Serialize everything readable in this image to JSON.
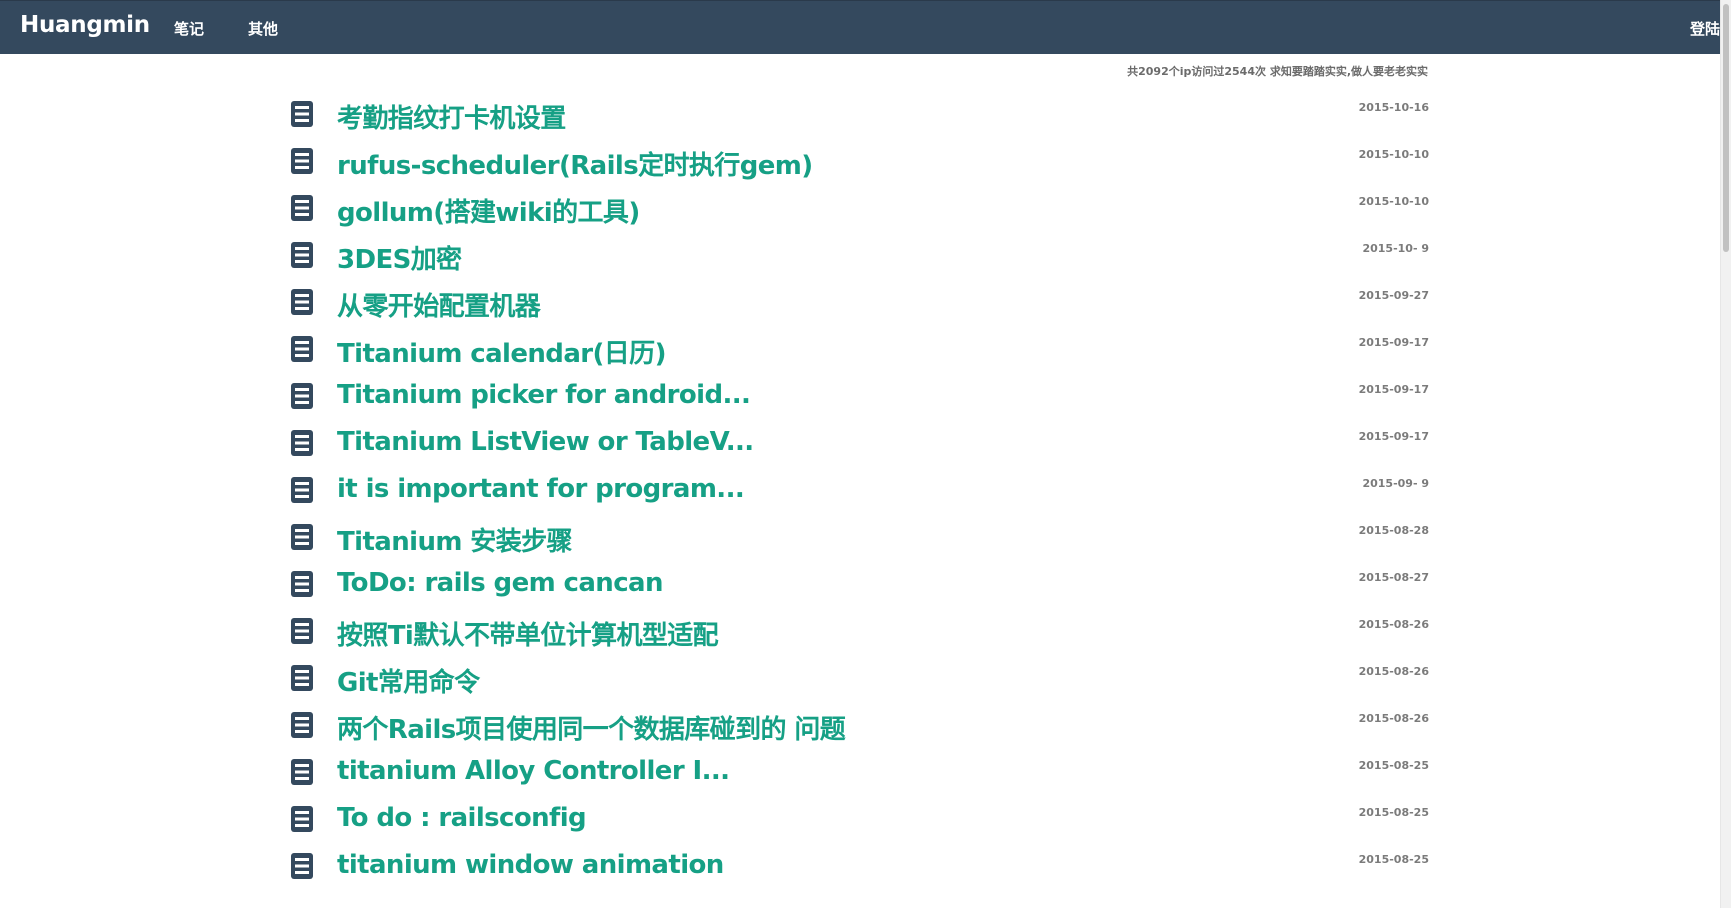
{
  "nav": {
    "brand": "Huangmin",
    "links": [
      "笔记",
      "其他"
    ],
    "login": "登陆"
  },
  "stats": {
    "text": "共2092个ip访问过2544次 求知要踏踏实实,做人要老老实实"
  },
  "icons": {
    "post": "document-icon"
  },
  "colors": {
    "navbar": "#34495e",
    "title": "#16a085",
    "icon": "#34495e"
  },
  "posts": [
    {
      "title": "考勤指纹打卡机设置",
      "date": "2015-10-16"
    },
    {
      "title": "rufus-scheduler(Rails定时执行gem)",
      "date": "2015-10-10"
    },
    {
      "title": "gollum(搭建wiki的工具)",
      "date": "2015-10-10"
    },
    {
      "title": "3DES加密",
      "date": "2015-10- 9"
    },
    {
      "title": "从零开始配置机器",
      "date": "2015-09-27"
    },
    {
      "title": "Titanium calendar(日历)",
      "date": "2015-09-17"
    },
    {
      "title": "Titanium picker for android...",
      "date": "2015-09-17"
    },
    {
      "title": "Titanium ListView or TableV...",
      "date": "2015-09-17"
    },
    {
      "title": "it is important for program...",
      "date": "2015-09- 9"
    },
    {
      "title": "Titanium 安装步骤",
      "date": "2015-08-28"
    },
    {
      "title": "ToDo: rails gem cancan",
      "date": "2015-08-27"
    },
    {
      "title": "按照Ti默认不带单位计算机型适配",
      "date": "2015-08-26"
    },
    {
      "title": "Git常用命令",
      "date": "2015-08-26"
    },
    {
      "title": "两个Rails项目使用同一个数据库碰到的 问题",
      "date": "2015-08-26"
    },
    {
      "title": "titanium Alloy Controller I...",
      "date": "2015-08-25"
    },
    {
      "title": "To do : railsconfig",
      "date": "2015-08-25"
    },
    {
      "title": "titanium window animation",
      "date": "2015-08-25"
    }
  ]
}
